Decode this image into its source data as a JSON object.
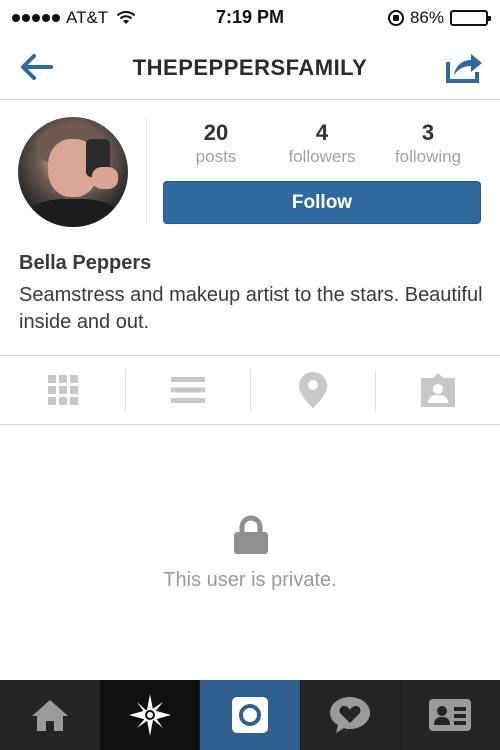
{
  "status_bar": {
    "carrier": "AT&T",
    "time": "7:19 PM",
    "battery_percent": "86%",
    "battery_level": 0.86,
    "icons": [
      "signal-dots-icon",
      "wifi-icon",
      "rotation-lock-icon",
      "battery-icon"
    ]
  },
  "header": {
    "title": "THEPEPPERSFAMILY",
    "back_icon": "back-arrow-icon",
    "share_icon": "share-icon"
  },
  "profile": {
    "stats": [
      {
        "value": "20",
        "label": "posts"
      },
      {
        "value": "4",
        "label": "followers"
      },
      {
        "value": "3",
        "label": "following"
      }
    ],
    "follow_label": "Follow",
    "name": "Bella Peppers",
    "bio": "Seamstress and makeup artist to the stars. Beautiful inside and out."
  },
  "view_toggles": [
    "grid-icon",
    "list-icon",
    "location-pin-icon",
    "tagged-photos-icon"
  ],
  "private_message": "This user is private.",
  "tab_bar": [
    "home-icon",
    "explore-icon",
    "camera-icon",
    "activity-icon",
    "profile-icon"
  ],
  "colors": {
    "accent": "#2f6a9f",
    "icon_gray": "#c8c8c8",
    "tabbar_bg": "#252525",
    "tab_active_bg": "#2f5f8c"
  }
}
